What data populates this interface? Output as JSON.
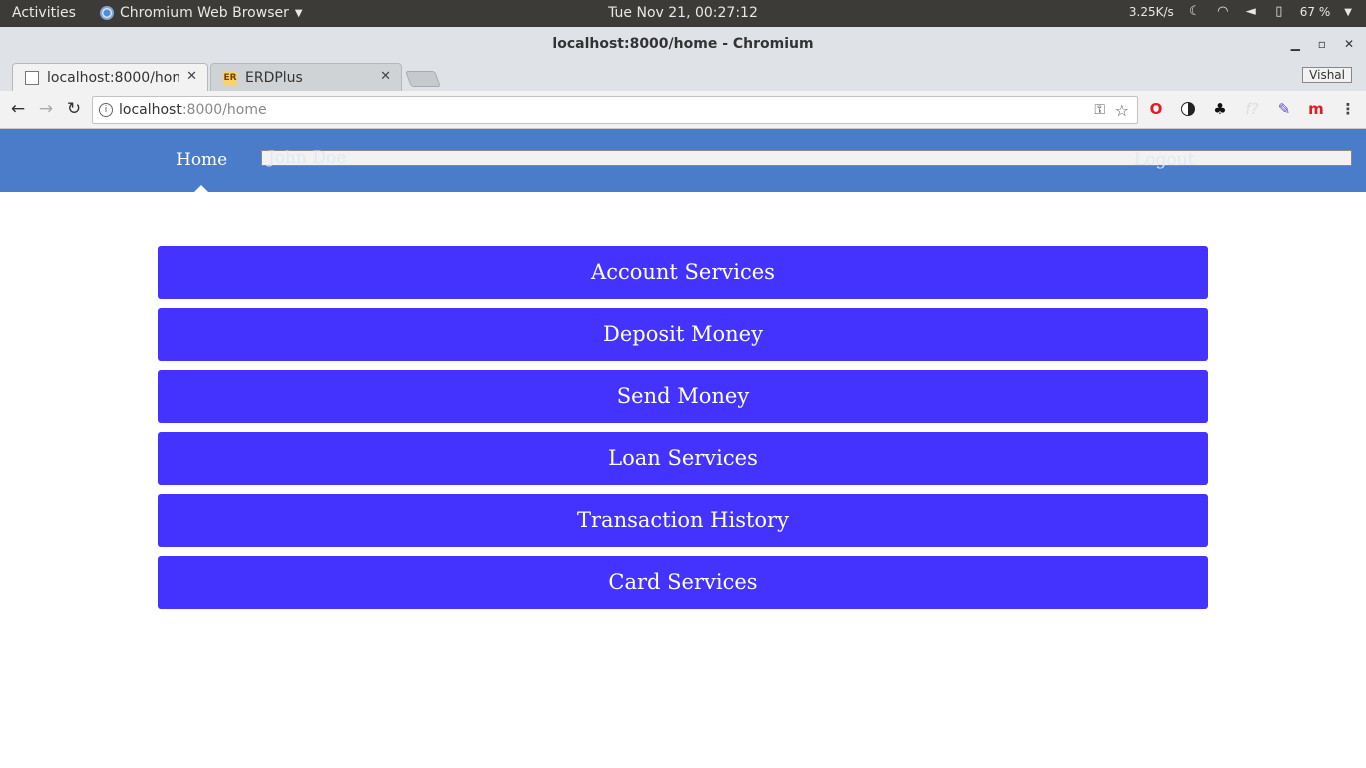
{
  "system_bar": {
    "activities": "Activities",
    "app_name": "Chromium Web Browser",
    "clock": "Tue Nov 21, 00:27:12",
    "net_speed": "3.25K/s",
    "battery": "67 %"
  },
  "window": {
    "title": "localhost:8000/home - Chromium",
    "profile_name": "Vishal"
  },
  "tabs": [
    {
      "label": "localhost:8000/hom",
      "favicon": "page-icon"
    },
    {
      "label": "ERDPlus",
      "favicon": "ER"
    }
  ],
  "address_bar": {
    "host": "localhost",
    "path": ":8000/home"
  },
  "page": {
    "nav": {
      "home": "Home",
      "user": "John Doe",
      "logout": "Logout"
    },
    "menu": [
      "Account Services",
      "Deposit Money",
      "Send Money",
      "Loan Services",
      "Transaction History",
      "Card Services"
    ]
  },
  "colors": {
    "navbar": "#4a7cc9",
    "button": "#4433ff",
    "system_bar": "#3c3b37"
  }
}
